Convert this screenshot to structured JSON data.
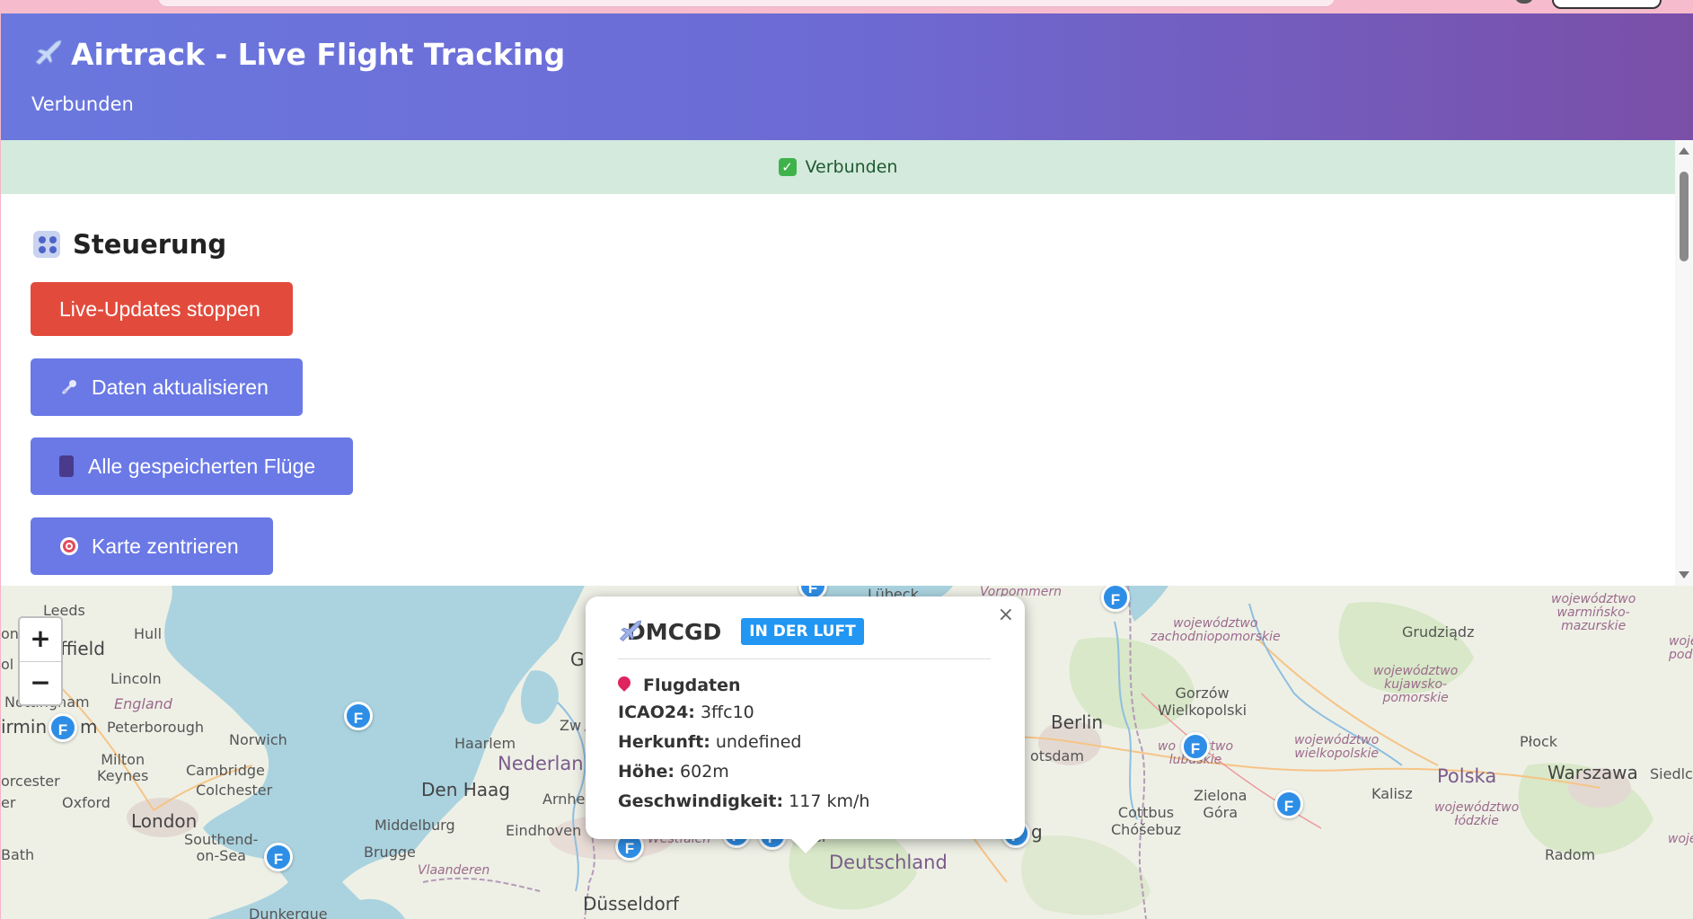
{
  "header": {
    "title": "Airtrack - Live Flight Tracking",
    "subtitle": "Verbunden"
  },
  "status_bar": {
    "text": "Verbunden",
    "icon": "check-icon",
    "color": "#d4eadc"
  },
  "controls": {
    "title": "Steuerung",
    "buttons": [
      {
        "label": "Live-Updates stoppen",
        "icon": "",
        "color": "#e24b3c"
      },
      {
        "label": "Daten aktualisieren",
        "icon": "satellite-icon",
        "color": "#6a79e6"
      },
      {
        "label": "Alle gespeicherten Flüge",
        "icon": "cabinet-icon",
        "color": "#6a79e6"
      },
      {
        "label": "Karte zentrieren",
        "icon": "target-icon",
        "color": "#6a79e6"
      }
    ]
  },
  "map": {
    "zoom_in": "+",
    "zoom_out": "−",
    "marker_label": "F",
    "labels": {
      "leeds": "Leeds",
      "hull": "Hull",
      "sheffield": "ffield",
      "lincoln": "Lincoln",
      "nottingham": "Nottingham",
      "england": "England",
      "peterborough": "Peterborough",
      "norwich": "Norwich",
      "birmingham": "irmin",
      "birmingham_end": "m",
      "milton_keynes": "Milton\nKeynes",
      "cambridge": "Cambridge",
      "colchester": "Colchester",
      "worcester": "orcester",
      "oxford": "Oxford",
      "london": "London",
      "southend": "Southend-\non-Sea",
      "bath": "Bath",
      "dunkerque": "Dunkerque",
      "haarlem": "Haarlem",
      "nederland": "Nederlan",
      "den_haag": "Den Haag",
      "middelburg": "Middelburg",
      "brugge": "Brugge",
      "vlaanderen": "Vlaanderen",
      "eindhoven": "Eindhoven",
      "arnhem": "Arnhe",
      "zwolle": "Zw",
      "g": "G",
      "dusseldorf": "Düsseldorf",
      "nrw": "Nordrhein-\nWestfalen",
      "deutschland": "Deutschland",
      "lubeck": "Lübeck",
      "vorpommern": "Vorpommern",
      "berlin": "Berlin",
      "potsdam": "otsdam",
      "leipzig": "Leip",
      "leipzig_end": "g",
      "cottbus": "Cottbus\nChóšebuz",
      "kassel": "el",
      "on": "on",
      "ol": "ol",
      "er": "er",
      "zachodniopomorskie": "województwo\nzachodniopomorskie",
      "grudziadz": "Grudziądz",
      "warminsko": "województwo\nwarmińsko-\nmazurskie",
      "gorzow": "Gorzów\nWielkopolski",
      "kujawsko": "województwo\nkujawsko-\npomorskie",
      "plock": "Płock",
      "wielkopolskie": "województwo\nwielkopolskie",
      "lubuskie": "wo     dztwo\nlubuskie",
      "polska": "Polska",
      "warszawa": "Warszawa",
      "siedlce": "Siedlce",
      "kalisz": "Kalisz",
      "zielona_gora": "Zielona\nGóra",
      "lodzkie": "województwo\nłódzkie",
      "radom": "Radom",
      "woj_right": "woje\npod",
      "woj_right2": "woje"
    }
  },
  "popup": {
    "close": "×",
    "callsign": "DMCGD",
    "status_badge": "IN DER LUFT",
    "section_title": "Flugdaten",
    "fields": [
      {
        "label": "ICAO24:",
        "value": "3ffc10"
      },
      {
        "label": "Herkunft:",
        "value": "undefined"
      },
      {
        "label": "Höhe:",
        "value": "602m"
      },
      {
        "label": "Geschwindigkeit:",
        "value": "117 km/h"
      }
    ]
  }
}
